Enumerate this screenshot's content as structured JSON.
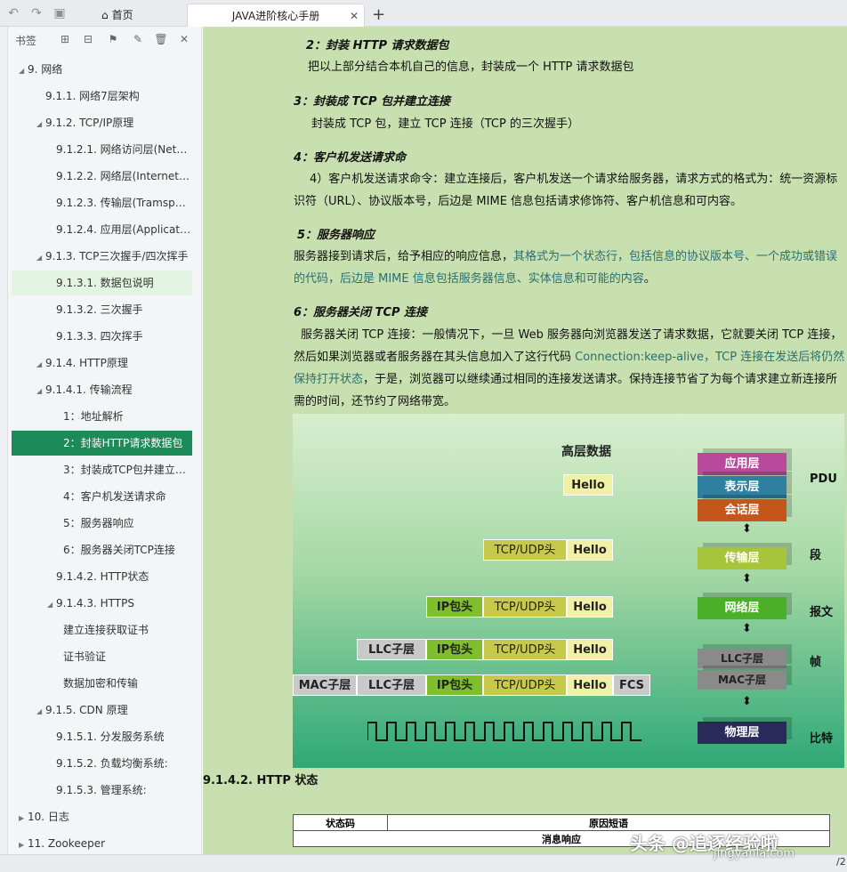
{
  "topbar": {
    "tab_home": "首页",
    "tab_doc": "JAVA进阶核心手册",
    "tab_close": "✕",
    "tab_add": "+"
  },
  "sidebar": {
    "title": "书签",
    "toc": [
      {
        "label": "9. 网络",
        "caret": "◢"
      },
      {
        "label": "9.1.1. 网络7层架构",
        "caret": ""
      },
      {
        "label": "9.1.2. TCP/IP原理",
        "caret": "◢"
      },
      {
        "label": "9.1.2.1. 网络访问层(Networ...",
        "caret": ""
      },
      {
        "label": "9.1.2.2. 网络层(Internet Lay...",
        "caret": ""
      },
      {
        "label": "9.1.2.3. 传输层(Tramsport ...",
        "caret": ""
      },
      {
        "label": "9.1.2.4. 应用层(Application...",
        "caret": ""
      },
      {
        "label": "9.1.3. TCP三次握手/四次挥手",
        "caret": "◢"
      },
      {
        "label": "9.1.3.1. 数据包说明",
        "caret": ""
      },
      {
        "label": "9.1.3.2. 三次握手",
        "caret": ""
      },
      {
        "label": "9.1.3.3. 四次挥手",
        "caret": ""
      },
      {
        "label": "9.1.4. HTTP原理",
        "caret": "◢"
      },
      {
        "label": "9.1.4.1. 传输流程",
        "caret": "◢"
      },
      {
        "label": "1：地址解析",
        "caret": ""
      },
      {
        "label": "2：封装HTTP请求数据包",
        "caret": ""
      },
      {
        "label": "3：封装成TCP包并建立连接",
        "caret": ""
      },
      {
        "label": "4：客户机发送请求命",
        "caret": ""
      },
      {
        "label": "5：服务器响应",
        "caret": ""
      },
      {
        "label": "6：服务器关闭TCP连接",
        "caret": ""
      },
      {
        "label": "9.1.4.2. HTTP状态",
        "caret": ""
      },
      {
        "label": "9.1.4.3. HTTPS",
        "caret": "◢"
      },
      {
        "label": "建立连接获取证书",
        "caret": ""
      },
      {
        "label": "证书验证",
        "caret": ""
      },
      {
        "label": "数据加密和传输",
        "caret": ""
      },
      {
        "label": "9.1.5. CDN 原理",
        "caret": "◢"
      },
      {
        "label": "9.1.5.1. 分发服务系统",
        "caret": ""
      },
      {
        "label": "9.1.5.2. 负载均衡系统:",
        "caret": ""
      },
      {
        "label": "9.1.5.3. 管理系统:",
        "caret": ""
      },
      {
        "label": "10. 日志",
        "caret": "▶"
      },
      {
        "label": "11. Zookeeper",
        "caret": "▶"
      }
    ]
  },
  "content": {
    "s2_title": "2：封装 HTTP 请求数据包",
    "s2_text": "把以上部分结合本机自己的信息，封装成一个 HTTP 请求数据包",
    "s3_title": "3：封装成 TCP 包并建立连接",
    "s3_text": "封装成 TCP 包，建立 TCP 连接（TCP 的三次握手）",
    "s4_title": "4：客户机发送请求命",
    "s4_text": "4）客户机发送请求命令：建立连接后，客户机发送一个请求给服务器，请求方式的格式为：统一资源标识符（URL）、协议版本号，后边是 MIME 信息包括请求修饰符、客户机信息和可内容。",
    "s5_title": "5：服务器响应",
    "s5_text_a": "服务器接到请求后，给予相应的响应信息，",
    "s5_text_b": "其格式为一个状态行，包括信息的协议版本号、一个成功或错误的代码，后边是 MIME 信息包括服务器信息、实体信息和可能的内容",
    "s5_text_c": "。",
    "s6_title": "6：服务器关闭 TCP 连接",
    "s6_text_a": "服务器关闭 TCP 连接：一般情况下，一旦 Web 服务器向浏览器发送了请求数据，它就要关闭 TCP 连接，然后如果浏览器或者服务器在其头信息加入了这行代码 ",
    "s6_text_b": "Connection:keep-alive，TCP 连接在发送后将仍然保持打开状态",
    "s6_text_c": "，于是，浏览器可以继续通过相同的连接发送请求。保持连接节省了为每个请求建立新连接所需的时间，还节约了网络带宽。",
    "http_heading": "9.1.4.2.     HTTP 状态",
    "table": {
      "col1": "状态码",
      "col2": "原因短语",
      "row2": "消息响应"
    }
  },
  "figure": {
    "top_label": "高层数据",
    "hello": "Hello",
    "tcp": "TCP/UDP头",
    "ip": "IP包头",
    "llc": "LLC子层",
    "mac": "MAC子层",
    "fcs": "FCS",
    "layers": [
      "应用层",
      "表示层",
      "会话层",
      "传输层",
      "网络层",
      "LLC子层",
      "MAC子层",
      "物理层"
    ],
    "labels": [
      "PDU",
      "段",
      "报文",
      "帧",
      "比特"
    ],
    "layer_colors": [
      "#b84a9c",
      "#2e7fa0",
      "#c4561c",
      "#a8c43a",
      "#4caf2a",
      "#8a8a8a",
      "#8a8a8a",
      "#2a2a5a"
    ]
  },
  "watermark": {
    "line1": "头条 @追逐经验啦",
    "line2": "jingyanla.com"
  },
  "page_num": "/2"
}
